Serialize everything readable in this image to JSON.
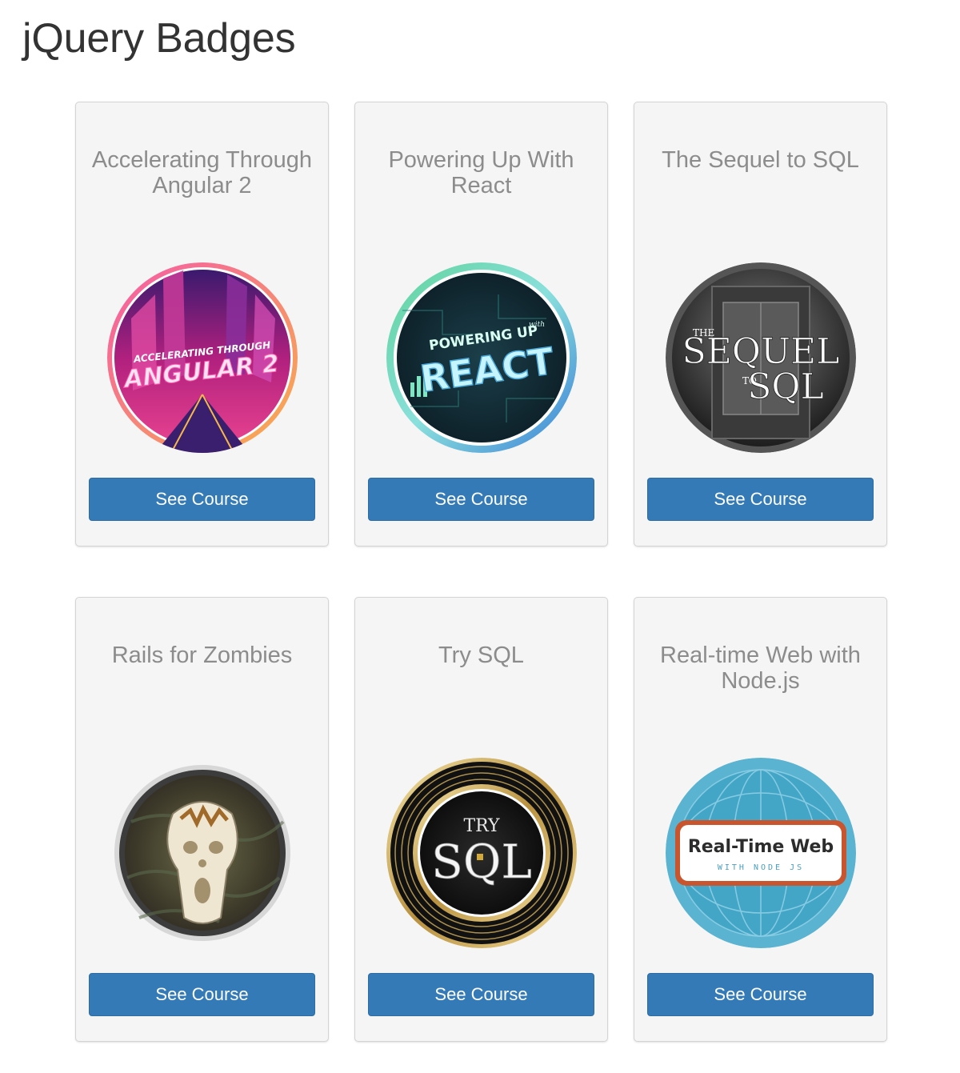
{
  "page": {
    "title": "jQuery Badges"
  },
  "colors": {
    "button_bg": "#337ab7",
    "card_bg": "#f5f5f5",
    "title_text": "#333333",
    "card_title_text": "#8c8c8c"
  },
  "cards": [
    {
      "title": "Accelerating Through Angular 2",
      "badge_icon": "angular-badge-icon",
      "badge_text": [
        "ACCELERATING THROUGH",
        "ANGULAR 2"
      ],
      "button_label": "See Course"
    },
    {
      "title": "Powering Up With React",
      "badge_icon": "react-badge-icon",
      "badge_text": [
        "POWERING UP",
        "with",
        "REACT"
      ],
      "button_label": "See Course"
    },
    {
      "title": "The Sequel to SQL",
      "badge_icon": "sequel-sql-badge-icon",
      "badge_text": [
        "THE",
        "SEQUEL",
        "TO",
        "SQL"
      ],
      "button_label": "See Course"
    },
    {
      "title": "Rails for Zombies",
      "badge_icon": "zombie-scream-badge-icon",
      "button_label": "See Course"
    },
    {
      "title": "Try SQL",
      "badge_icon": "try-sql-badge-icon",
      "badge_text": [
        "TRY",
        "SQL"
      ],
      "button_label": "See Course"
    },
    {
      "title": "Real-time Web with Node.js",
      "badge_icon": "realtime-web-globe-badge-icon",
      "badge_text": [
        "Real-Time Web",
        "WITH NODE JS"
      ],
      "button_label": "See Course"
    }
  ]
}
